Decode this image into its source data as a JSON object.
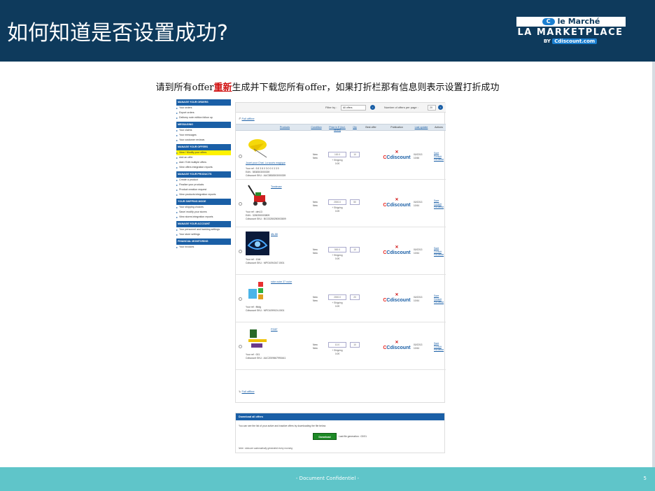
{
  "slide": {
    "title": "如何知道是否设置成功?",
    "subtitle_pre": "请到所有offer",
    "subtitle_em": "重新",
    "subtitle_post": "生成并下载您所有offer，如果打折栏那有信息则表示设置打折成功",
    "footer": "- Document Confidentiel -",
    "page": "5",
    "colors": {
      "header": "#0e3a5c",
      "footer": "#5fc5c9",
      "accent": "#1a5fa6",
      "highlight": "#fff200",
      "emphasis": "#d01010"
    }
  },
  "logo": {
    "line1": "le Marché",
    "line2": "LA MARKETPLACE",
    "line3_pre": "BY",
    "line3_brand": "Cdiscount.com"
  },
  "sidebar": {
    "sections": [
      {
        "header": "MANAGE YOUR ORDERS",
        "items": [
          "Your orders",
          "Export orders",
          "Delivery note edition follow up"
        ]
      },
      {
        "header": "MESSAGING",
        "items": [
          "Your claims",
          "Your messages",
          "Your customer reviews"
        ]
      },
      {
        "header": "MANAGE YOUR OFFERS",
        "items": [
          "View / Modify your offers",
          "Add an offer",
          "Add / Edit multiple offers",
          "View offers integration reports"
        ]
      },
      {
        "header": "MANAGE YOUR PRODUCTS",
        "items": [
          "Create a product",
          "Finalize your products",
          "Product creation request",
          "View products integration reports"
        ]
      },
      {
        "header": "YOUR SHIPPING MODE",
        "items": [
          "Your shipping choices",
          "Save/ modify your stores",
          "View stores integration reports"
        ]
      },
      {
        "header": "MANAGE YOUR ACCOUNT",
        "items": [
          "Your personnel and banking settings",
          "Your store settings"
        ]
      },
      {
        "header": "FINANCIAL MONITORING",
        "items": [
          "Your invoices"
        ]
      }
    ],
    "active_item": "View / Modify your offers"
  },
  "filter": {
    "filter_label": "Filter by :",
    "filter_value": "All offers",
    "per_page_label": "Number of offers per page :",
    "per_page_value": "20"
  },
  "full_offline": "Full offline",
  "table": {
    "headers": [
      "Products",
      "Condition",
      "Price in € (incl. taxes)",
      "Qty",
      "Best offer",
      "Publication",
      "Last update",
      "Actions"
    ],
    "rows": [
      {
        "name": "Jouet pour Chat, La souris magique",
        "ref": "Your ref : 5 8 3 8 0 3 0 0 0 3 3 9",
        "ean": "EAN : 5838303000339",
        "sku": "Cdiscount SKU : AUC5838303000339",
        "condition": "New",
        "price": "100.0",
        "shipping": "+ Shipping",
        "shipping_val": "0.0€",
        "qty": "10",
        "updated_date": "01/02/13",
        "updated_time": "10:56"
      },
      {
        "name": "Tondeuse",
        "ref": "Your ref : dev13",
        "ean": "EAN : 3280250003809",
        "sku": "Cdiscount SKU : BCO3280250003809",
        "condition": "New",
        "price": "2000.0",
        "shipping": "+ Shipping",
        "shipping_val": "0.0€",
        "qty": "50",
        "updated_date": "01/02/13",
        "updated_time": "10:54"
      },
      {
        "name": "dfs 88",
        "ref": "Your ref : 10dt",
        "ean": "",
        "sku": "Cdiscount SKU : MPO1094347-0001",
        "condition": "New",
        "price": "500.0",
        "shipping": "+ Shipping",
        "shipping_val": "0.0€",
        "qty": "10",
        "updated_date": "01/02/13",
        "updated_time": "10:54"
      },
      {
        "name": "robe noire 37 noire",
        "ref": "Your ref : ffddg",
        "ean": "",
        "sku": "Cdiscount SKU : MPO1099024-0001",
        "condition": "New",
        "price": "2000.0",
        "shipping": "+ Shipping",
        "shipping_val": "0.0€",
        "qty": "20",
        "updated_date": "01/02/13",
        "updated_time": "10:54"
      },
      {
        "name": "FSGF",
        "ref": "Your ref : 001",
        "ean": "",
        "sku": "Cdiscount SKU : AUC2009667990441",
        "condition": "New",
        "price": "10.0",
        "shipping": "+ Shipping",
        "shipping_val": "0.0€",
        "qty": "10",
        "updated_date": "01/02/13",
        "updated_time": "10:54"
      }
    ],
    "publication_brand": "Cdiscount",
    "actions": [
      "Save",
      "Consult",
      "Put offline"
    ]
  },
  "download": {
    "header": "Download all offers",
    "text": "You can see the list of your active and inactive offers by downloading the file below:",
    "button": "Download",
    "last_gen": "Last file generation : 02/01",
    "note": "Note : data are automatically generated every morning"
  }
}
